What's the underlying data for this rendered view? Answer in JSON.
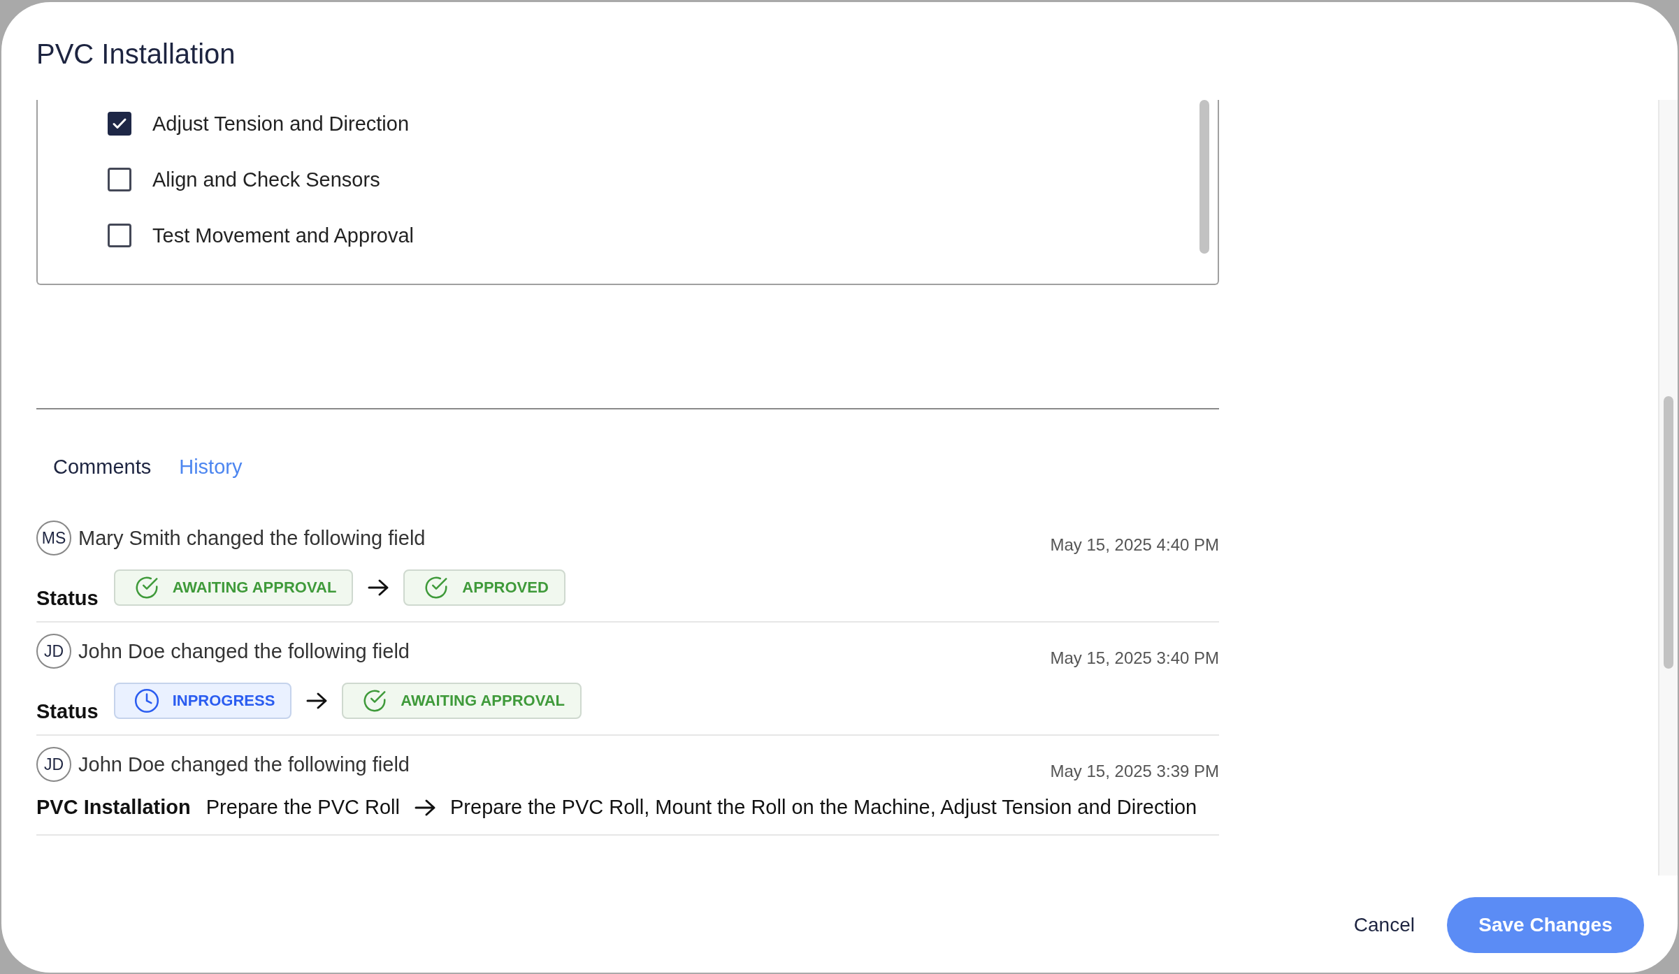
{
  "dialog": {
    "title": "PVC Installation"
  },
  "checklist": [
    {
      "label": "Adjust Tension and Direction",
      "checked": true
    },
    {
      "label": "Align and Check Sensors",
      "checked": false
    },
    {
      "label": "Test Movement and Approval",
      "checked": false
    }
  ],
  "tabs": [
    {
      "label": "Comments",
      "selected": false
    },
    {
      "label": "History",
      "selected": true
    }
  ],
  "history": [
    {
      "initials": "MS",
      "summary": "Mary Smith changed the following field",
      "time": "May 15, 2025 4:40 PM",
      "field": "Status",
      "kind": "status",
      "from": {
        "label": "AWAITING APPROVAL",
        "kind": "done"
      },
      "to": {
        "label": "APPROVED",
        "kind": "done"
      }
    },
    {
      "initials": "JD",
      "summary": "John Doe changed the following field",
      "time": "May 15, 2025 3:40 PM",
      "field": "Status",
      "kind": "status",
      "from": {
        "label": "INPROGRESS",
        "kind": "progress"
      },
      "to": {
        "label": "AWAITING APPROVAL",
        "kind": "done"
      }
    },
    {
      "initials": "JD",
      "summary": "John Doe changed the following field",
      "time": "May 15, 2025 3:39 PM",
      "field": "PVC Installation",
      "kind": "text",
      "from": "Prepare the PVC Roll",
      "to": "Prepare the PVC Roll, Mount the Roll on the Machine, Adjust Tension and Direction"
    }
  ],
  "buttons": {
    "cancel": "Cancel",
    "save": "Save Changes"
  }
}
